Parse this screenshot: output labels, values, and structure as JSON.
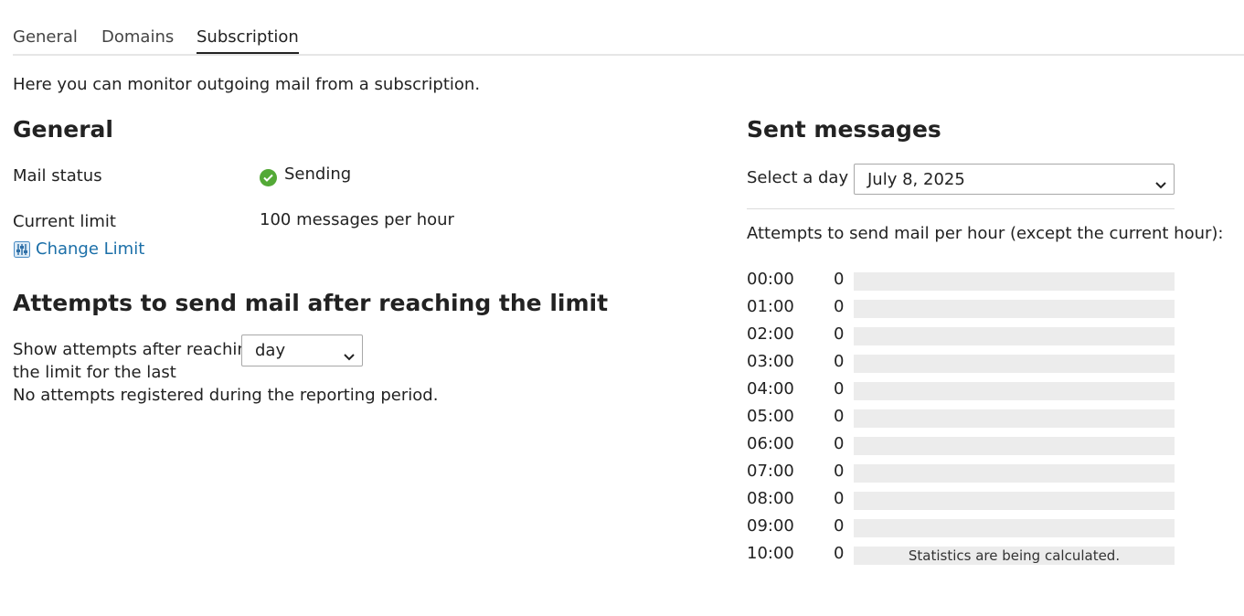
{
  "tabs": [
    {
      "label": "General",
      "active": false
    },
    {
      "label": "Domains",
      "active": false
    },
    {
      "label": "Subscription",
      "active": true
    }
  ],
  "intro": "Here you can monitor outgoing mail from a subscription.",
  "general": {
    "heading": "General",
    "mail_status_label": "Mail status",
    "mail_status_value": "Sending",
    "current_limit_label": "Current limit",
    "current_limit_value": "100 messages per hour",
    "change_limit_link": "Change Limit"
  },
  "attempts": {
    "heading": "Attempts to send mail after reaching the limit",
    "show_label_line1": "Show attempts after reaching",
    "show_label_line2": "the limit for the last",
    "period_select": "day",
    "no_attempts": "No attempts registered during the reporting period."
  },
  "sent": {
    "heading": "Sent messages",
    "select_day_label": "Select a day :",
    "selected_day": "July 8, 2025",
    "per_hour_caption": "Attempts to send mail per hour (except the current hour):",
    "hours": [
      {
        "hour": "00:00",
        "count": "0",
        "note": ""
      },
      {
        "hour": "01:00",
        "count": "0",
        "note": ""
      },
      {
        "hour": "02:00",
        "count": "0",
        "note": ""
      },
      {
        "hour": "03:00",
        "count": "0",
        "note": ""
      },
      {
        "hour": "04:00",
        "count": "0",
        "note": ""
      },
      {
        "hour": "05:00",
        "count": "0",
        "note": ""
      },
      {
        "hour": "06:00",
        "count": "0",
        "note": ""
      },
      {
        "hour": "07:00",
        "count": "0",
        "note": ""
      },
      {
        "hour": "08:00",
        "count": "0",
        "note": ""
      },
      {
        "hour": "09:00",
        "count": "0",
        "note": ""
      },
      {
        "hour": "10:00",
        "count": "0",
        "note": "Statistics are being calculated."
      }
    ]
  },
  "colors": {
    "accent_link": "#1b6fa8",
    "status_ok": "#53a936",
    "bar_bg": "#ececec"
  },
  "icons": {
    "status": "check-circle-icon",
    "change_limit": "sliders-icon",
    "dropdown": "chevron-down-icon"
  }
}
